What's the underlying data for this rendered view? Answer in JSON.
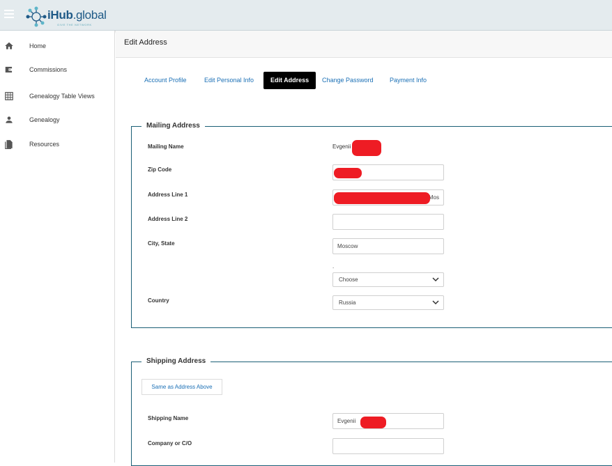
{
  "app": {
    "logo_primary": "iHub",
    "logo_secondary": ".global",
    "logo_tagline": "GIVE THE NETWORK",
    "brand_color": "#1f5a87"
  },
  "sidebar": {
    "items": [
      {
        "label": "Home",
        "icon": "home-icon"
      },
      {
        "label": "Commissions",
        "icon": "wallet-icon"
      },
      {
        "label": "Genealogy Table Views",
        "icon": "table-icon"
      },
      {
        "label": "Genealogy",
        "icon": "person-icon"
      },
      {
        "label": "Resources",
        "icon": "document-icon"
      }
    ]
  },
  "header": {
    "title": "Edit Address"
  },
  "tabs": [
    {
      "label": "Account Profile",
      "active": false
    },
    {
      "label": "Edit Personal Info",
      "active": false
    },
    {
      "label": "Edit Address",
      "active": true
    },
    {
      "label": "Change Password",
      "active": false
    },
    {
      "label": "Payment Info",
      "active": false
    }
  ],
  "mailing": {
    "legend": "Mailing Address",
    "mailing_name_label": "Mailing Name",
    "mailing_name_value": "Evgenii",
    "zip_label": "Zip Code",
    "zip_value": "",
    "address1_label": "Address Line 1",
    "address1_value": "Mos",
    "address2_label": "Address Line 2",
    "address2_value": "",
    "city_state_label": "City, State",
    "city_value": "Moscow",
    "state_dot": ".",
    "state_select": "Choose",
    "country_label": "Country",
    "country_select": "Russia"
  },
  "shipping": {
    "legend": "Shipping Address",
    "same_button": "Same as Address Above",
    "shipping_name_label": "Shipping Name",
    "shipping_name_value": "Evgenii",
    "company_label": "Company or C/O",
    "company_value": ""
  }
}
